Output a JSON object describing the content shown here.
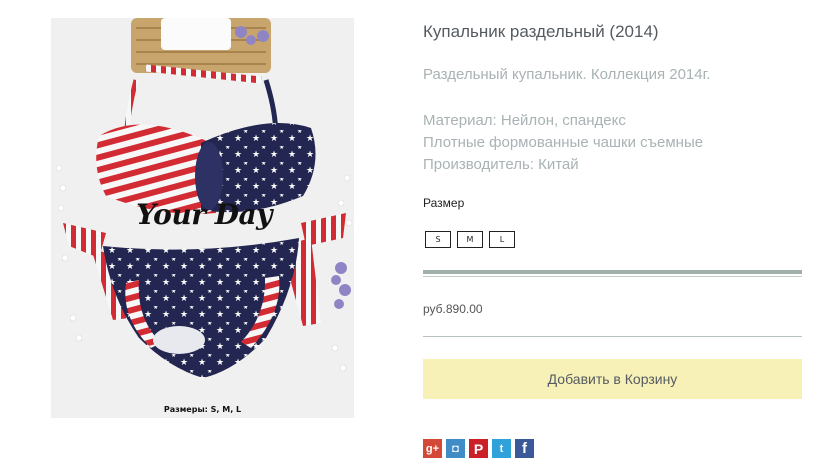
{
  "product": {
    "title": "Купальник раздельный (2014)",
    "description": "Раздельный купальник. Коллекция 2014г.",
    "specs": [
      "Материал: Нейлон, спандекс",
      "Плотные формованные чашки съемные",
      "Производитель: Китай"
    ],
    "size_label": "Размер",
    "sizes": [
      "S",
      "M",
      "L"
    ],
    "price": "руб.890.00",
    "add_to_cart": "Добавить в Корзину"
  },
  "image": {
    "brand_text": "Your Day",
    "caption": "Размеры: S, M, L"
  },
  "share": {
    "icons": [
      "google-plus-icon",
      "instagram-icon",
      "pinterest-icon",
      "twitter-icon",
      "facebook-icon"
    ],
    "glyphs": {
      "gplus": "g+",
      "ig": "◘",
      "pin": "P",
      "tw": "t",
      "fb": "f"
    }
  },
  "colors": {
    "title": "#555b61",
    "muted_text": "#a9b2b4",
    "cart_button_bg": "#f7f0b7",
    "divider": "#9fb0ad",
    "flag_red": "#d32b33",
    "flag_navy": "#222650"
  }
}
